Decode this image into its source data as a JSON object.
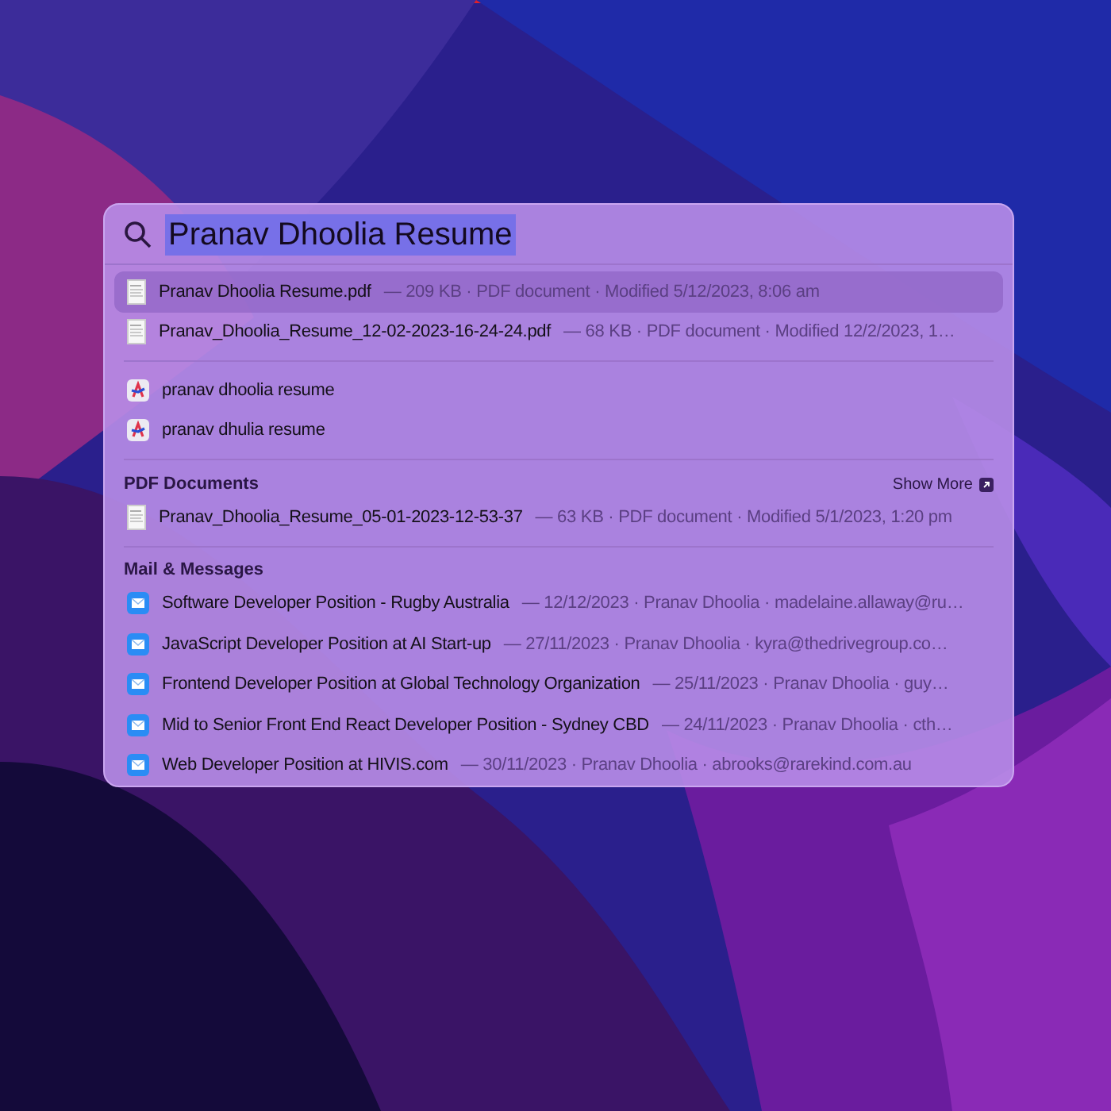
{
  "search": {
    "value": "Pranav Dhoolia Resume"
  },
  "top_hits": [
    {
      "name": "Pranav Dhoolia Resume.pdf",
      "details": "— 209 KB · PDF document · Modified 5/12/2023, 8:06 am",
      "selected": true
    },
    {
      "name": "Pranav_Dhoolia_Resume_12-02-2023-16-24-24.pdf",
      "details": "— 68 KB · PDF document · Modified 12/2/2023, 1…",
      "selected": false
    }
  ],
  "suggestions": [
    {
      "text": "pranav dhoolia resume"
    },
    {
      "text": "pranav dhulia resume"
    }
  ],
  "sections": [
    {
      "title": "PDF Documents",
      "show_more": "Show More",
      "kind": "file",
      "items": [
        {
          "name": "Pranav_Dhoolia_Resume_05-01-2023-12-53-37",
          "details": "— 63 KB · PDF document · Modified 5/1/2023, 1:20 pm"
        }
      ]
    },
    {
      "title": "Mail & Messages",
      "kind": "mail",
      "items": [
        {
          "name": "Software Developer Position - Rugby Australia",
          "details": "— 12/12/2023 · Pranav Dhoolia · madelaine.allaway@ru…"
        },
        {
          "name": "JavaScript Developer Position at AI Start-up",
          "details": "— 27/11/2023 · Pranav Dhoolia · kyra@thedrivegroup.co…"
        },
        {
          "name": "Frontend Developer Position at Global Technology Organization",
          "details": "— 25/11/2023 · Pranav Dhoolia · guy…"
        },
        {
          "name": "Mid to Senior Front End React Developer Position - Sydney CBD",
          "details": "— 24/11/2023 · Pranav Dhoolia · cth…"
        },
        {
          "name": "Web Developer Position at HIVIS.com",
          "details": "— 30/11/2023 · Pranav Dhoolia · abrooks@rarekind.com.au"
        }
      ]
    }
  ]
}
